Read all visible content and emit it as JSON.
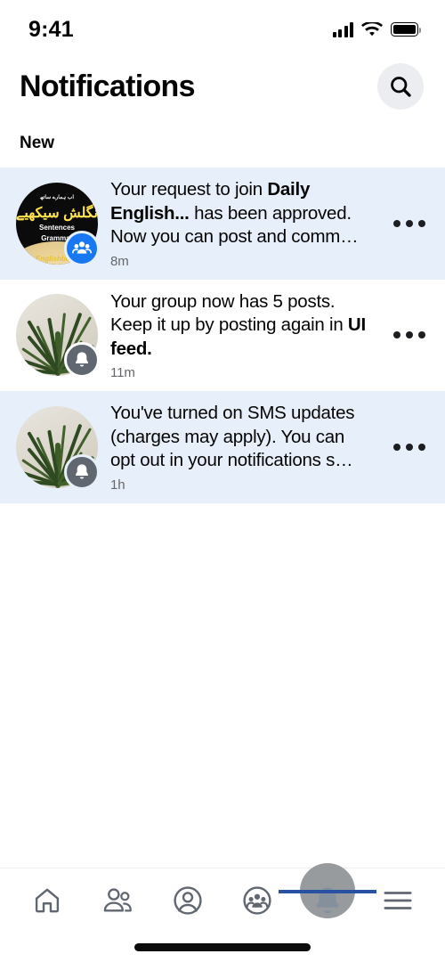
{
  "status_bar": {
    "time": "9:41",
    "cellular_icon": "signal-bars-icon",
    "wifi_icon": "wifi-icon",
    "battery_icon": "battery-full-icon"
  },
  "header": {
    "title": "Notifications",
    "search_icon": "search-icon"
  },
  "sections": [
    {
      "label": "New"
    }
  ],
  "notifications": [
    {
      "id": "notif-join-approved",
      "unread": true,
      "avatar_type": "group-photo",
      "avatar_alt": "Daily English group page logo",
      "avatar_lines": [
        "اب ہمارے ساتھ",
        "سپوکن انگلش سیکھیے",
        "Sentences",
        "Grammar",
        "Englishbook"
      ],
      "badge_icon": "group-badge-icon",
      "badge_color": "#1877F2",
      "text_parts": [
        {
          "t": "Your request to join ",
          "bold": false
        },
        {
          "t": "Daily English...",
          "bold": true
        },
        {
          "t": " has been approved. Now you can post and comm…",
          "bold": false
        }
      ],
      "time": "8m",
      "menu_icon": "more-options-icon"
    },
    {
      "id": "notif-group-posts",
      "unread": false,
      "avatar_type": "plant-photo",
      "avatar_alt": "Potted plant photo",
      "badge_icon": "bell-badge-icon",
      "badge_color": "#606770",
      "text_parts": [
        {
          "t": "Your group now has 5 posts. Keep it up by posting again in ",
          "bold": false
        },
        {
          "t": "UI feed.",
          "bold": true
        }
      ],
      "time": "11m",
      "menu_icon": "more-options-icon"
    },
    {
      "id": "notif-sms-updates",
      "unread": true,
      "avatar_type": "plant-photo",
      "avatar_alt": "Potted plant photo",
      "badge_icon": "bell-badge-icon",
      "badge_color": "#606770",
      "text_parts": [
        {
          "t": "You've turned on SMS updates (charges may apply). You can opt out in your notifications s…",
          "bold": false
        }
      ],
      "time": "1h",
      "menu_icon": "more-options-icon"
    }
  ],
  "bottom_nav": {
    "items": [
      {
        "name": "home",
        "icon": "home-icon",
        "active": false
      },
      {
        "name": "friends",
        "icon": "friends-icon",
        "active": false
      },
      {
        "name": "profile",
        "icon": "profile-icon",
        "active": false
      },
      {
        "name": "groups",
        "icon": "groups-icon",
        "active": false
      },
      {
        "name": "notifications",
        "icon": "bell-icon",
        "active": true
      },
      {
        "name": "menu",
        "icon": "hamburger-menu-icon",
        "active": false
      }
    ],
    "active_color": "#1877F2",
    "inactive_color": "#606770"
  },
  "home_indicator": "home-indicator-bar",
  "colors": {
    "unread_row": "#E7F0FA",
    "read_row": "#FFFFFF",
    "primary_text": "#050505",
    "secondary_text": "#65676B",
    "brand_blue": "#1877F2",
    "search_bg": "#EBEDF0"
  }
}
